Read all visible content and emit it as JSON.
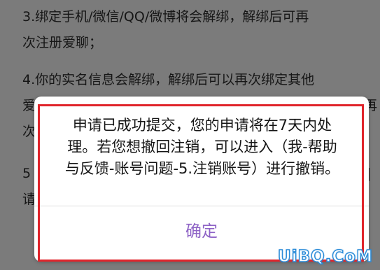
{
  "background": {
    "item3": {
      "line1": "3.绑定手机/微信/QQ/微博将会解绑，解绑后可再",
      "line2": "次注册爱聊；"
    },
    "item4": {
      "line1": "4.你的实名信息会解绑，解绑后可以再次绑定其他",
      "line2": "爱",
      "line2_right": "再",
      "line3": "次"
    },
    "item5": {
      "line1": "5",
      "line1_right": "|",
      "line2": "请"
    }
  },
  "dialog": {
    "message_lines": [
      "申请已成功提交，您的申请将在7天内处",
      "理。若您想撤回注销，可以进入（我-帮助",
      "与反馈-账号问题-5.注销账号）进行撤销。"
    ],
    "confirm_label": "确定",
    "accent_color": "#8e63c6"
  },
  "annotation": {
    "highlight_color": "#e0242b"
  },
  "watermark": {
    "text": "UiBQ.CoM"
  }
}
